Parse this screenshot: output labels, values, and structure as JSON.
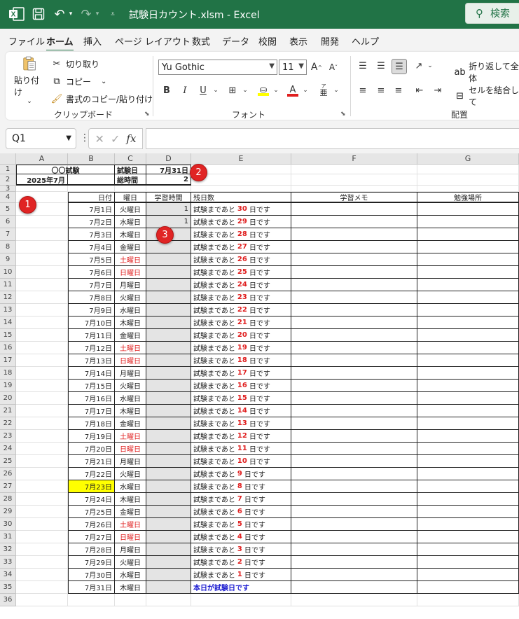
{
  "titlebar": {
    "logo": "X",
    "title": "試験日カウント.xlsm  -  Excel",
    "search_label": "検索"
  },
  "tabs": [
    "ファイル",
    "ホーム",
    "挿入",
    "ページ レイアウト",
    "数式",
    "データ",
    "校閲",
    "表示",
    "開発",
    "ヘルプ"
  ],
  "active_tab": "ホーム",
  "ribbon": {
    "clipboard": {
      "paste_label": "貼り付け",
      "cut_label": "切り取り",
      "copy_label": "コピー",
      "format_painter_label": "書式のコピー/貼り付け",
      "group_label": "クリップボード"
    },
    "font": {
      "font_name": "Yu Gothic",
      "font_size": "11",
      "grow_label": "A",
      "shrink_label": "A",
      "bold_label": "B",
      "italic_label": "I",
      "underline_label": "U",
      "font_color_label": "A",
      "phonetic_label": "亜",
      "group_label": "フォント"
    },
    "alignment": {
      "wrap_label": "折り返して全体",
      "merge_label": "セルを結合して",
      "group_label": "配置"
    }
  },
  "formula_bar": {
    "name_box": "Q1",
    "fx": "fx",
    "formula": ""
  },
  "columns": [
    "A",
    "B",
    "C",
    "D",
    "E",
    "F",
    "G"
  ],
  "row_numbers": [
    "1",
    "2",
    "3",
    "4",
    "5",
    "6",
    "7",
    "8",
    "9",
    "10",
    "11",
    "12",
    "13",
    "14",
    "15",
    "16",
    "17",
    "18",
    "19",
    "20",
    "21",
    "22",
    "23",
    "24",
    "25",
    "26",
    "27",
    "28",
    "29",
    "30",
    "31",
    "32",
    "33",
    "34",
    "35",
    "36"
  ],
  "header_block": {
    "a1": "〇〇試験",
    "c1": "試験日",
    "d1": "7月31日",
    "a2": "2025年7月",
    "c2": "総時間",
    "d2": "2"
  },
  "table_headers": {
    "date": "日付",
    "weekday": "曜日",
    "study_time": "学習時間",
    "remaining": "残日数",
    "memo": "学習メモ",
    "place": "勉強場所"
  },
  "remaining_prefix": "試験まであと",
  "remaining_suffix": "日です",
  "exam_day_text": "本日が試験日です",
  "rows": [
    {
      "date": "7月1日",
      "weekday": "火曜日",
      "hours": "1",
      "days": "30"
    },
    {
      "date": "7月2日",
      "weekday": "水曜日",
      "hours": "1",
      "days": "29"
    },
    {
      "date": "7月3日",
      "weekday": "木曜日",
      "hours": "",
      "days": "28"
    },
    {
      "date": "7月4日",
      "weekday": "金曜日",
      "hours": "",
      "days": "27"
    },
    {
      "date": "7月5日",
      "weekday": "土曜日",
      "hours": "",
      "days": "26",
      "weekend": true
    },
    {
      "date": "7月6日",
      "weekday": "日曜日",
      "hours": "",
      "days": "25",
      "weekend": true
    },
    {
      "date": "7月7日",
      "weekday": "月曜日",
      "hours": "",
      "days": "24"
    },
    {
      "date": "7月8日",
      "weekday": "火曜日",
      "hours": "",
      "days": "23"
    },
    {
      "date": "7月9日",
      "weekday": "水曜日",
      "hours": "",
      "days": "22"
    },
    {
      "date": "7月10日",
      "weekday": "木曜日",
      "hours": "",
      "days": "21"
    },
    {
      "date": "7月11日",
      "weekday": "金曜日",
      "hours": "",
      "days": "20"
    },
    {
      "date": "7月12日",
      "weekday": "土曜日",
      "hours": "",
      "days": "19",
      "weekend": true
    },
    {
      "date": "7月13日",
      "weekday": "日曜日",
      "hours": "",
      "days": "18",
      "weekend": true
    },
    {
      "date": "7月14日",
      "weekday": "月曜日",
      "hours": "",
      "days": "17"
    },
    {
      "date": "7月15日",
      "weekday": "火曜日",
      "hours": "",
      "days": "16"
    },
    {
      "date": "7月16日",
      "weekday": "水曜日",
      "hours": "",
      "days": "15"
    },
    {
      "date": "7月17日",
      "weekday": "木曜日",
      "hours": "",
      "days": "14"
    },
    {
      "date": "7月18日",
      "weekday": "金曜日",
      "hours": "",
      "days": "13"
    },
    {
      "date": "7月19日",
      "weekday": "土曜日",
      "hours": "",
      "days": "12",
      "weekend": true
    },
    {
      "date": "7月20日",
      "weekday": "日曜日",
      "hours": "",
      "days": "11",
      "weekend": true
    },
    {
      "date": "7月21日",
      "weekday": "月曜日",
      "hours": "",
      "days": "10"
    },
    {
      "date": "7月22日",
      "weekday": "火曜日",
      "hours": "",
      "days": "9"
    },
    {
      "date": "7月23日",
      "weekday": "水曜日",
      "hours": "",
      "days": "8",
      "highlight": true
    },
    {
      "date": "7月24日",
      "weekday": "木曜日",
      "hours": "",
      "days": "7"
    },
    {
      "date": "7月25日",
      "weekday": "金曜日",
      "hours": "",
      "days": "6"
    },
    {
      "date": "7月26日",
      "weekday": "土曜日",
      "hours": "",
      "days": "5",
      "weekend": true
    },
    {
      "date": "7月27日",
      "weekday": "日曜日",
      "hours": "",
      "days": "4",
      "weekend": true
    },
    {
      "date": "7月28日",
      "weekday": "月曜日",
      "hours": "",
      "days": "3"
    },
    {
      "date": "7月29日",
      "weekday": "火曜日",
      "hours": "",
      "days": "2"
    },
    {
      "date": "7月30日",
      "weekday": "水曜日",
      "hours": "",
      "days": "1"
    },
    {
      "date": "7月31日",
      "weekday": "木曜日",
      "hours": "",
      "days": "",
      "exam_day": true
    }
  ],
  "markers": [
    "1",
    "2",
    "3"
  ],
  "colors": {
    "excel_green": "#217346",
    "weekend_red": "#e02020",
    "exam_blue": "#1a1ad0",
    "today_yellow": "#ffff00",
    "marker_red": "#e02424"
  }
}
